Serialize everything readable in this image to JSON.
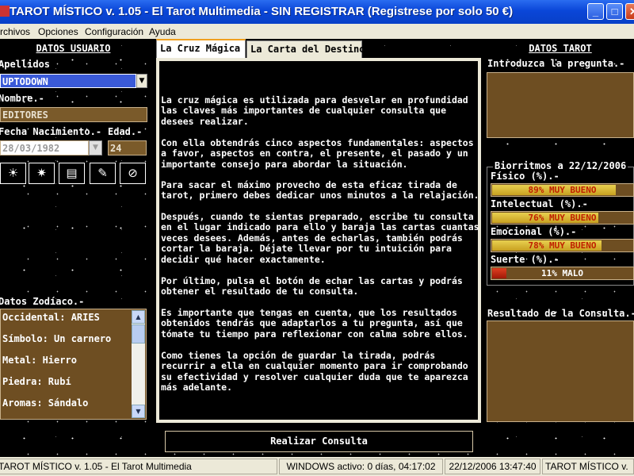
{
  "window": {
    "title": "TAROT MÍSTICO v. 1.05 - El Tarot Multimedia - SIN REGISTRAR (Registrese por solo 50 €)",
    "minimize": "_",
    "maximize": "□",
    "close": "✕"
  },
  "menu": [
    "Archivos",
    "Opciones",
    "Configuración",
    "Ayuda"
  ],
  "left": {
    "title": "DATOS USUARIO",
    "apellidos_label": "Apellidos",
    "apellidos_value": "UPTODOWN",
    "nombre_label": "Nombre.-",
    "nombre_value": "EDITORES",
    "fecha_label": "Fecha Nacimiento.-",
    "edad_label": "Edad.-",
    "fecha_value": "28/03/1982",
    "edad_value": "24",
    "zodiaco_label": "Datos Zodíaco.-",
    "zodiaco": [
      "Occidental: ARIES",
      "Símbolo: Un carnero",
      "Metal: Hierro",
      "Piedra: Rubí",
      "Aromas: Sándalo"
    ]
  },
  "tabs": [
    "La Cruz Mágica",
    "La Carta del Destino"
  ],
  "content": [
    "La cruz mágica es utilizada para desvelar en profundidad las claves más importantes de cualquier consulta que desees realizar.",
    "Con ella obtendrás cinco aspectos fundamentales: aspectos a favor, aspectos en contra, el presente, el pasado y un importante consejo para abordar la situación.",
    "Para sacar el máximo provecho de esta eficaz tirada de tarot, primero debes dedicar unos minutos a la relajación.",
    "Después, cuando te sientas preparado, escribe tu consulta en el lugar indicado para ello y baraja las cartas cuantas veces desees. Además, antes de echarlas, también podrás cortar la baraja. Déjate llevar por tu intuición para decidir qué hacer exactamente.",
    "Por último, pulsa el botón de echar las cartas y podrás obtener el resultado de tu consulta.",
    "Es importante que tengas en cuenta, que los resultados obtenidos tendrás que adaptarlos a tu pregunta, así que tómate tu tiempo para reflexionar con calma sobre ellos.",
    "Como tienes la opción de guardar la tirada, podrás recurrir a ella en cualquier momento para ir comprobando su efectividad y resolver cualquier duda que te aparezca más adelante."
  ],
  "right": {
    "title": "DATOS TAROT",
    "pregunta_label": "Introduzca la pregunta.-",
    "bio_title": "Biorritmos a 22/12/2006",
    "bio": [
      {
        "label": "Físico (%).-",
        "percent": 89,
        "text": "89% MUY BUENO"
      },
      {
        "label": "Intelectual (%).-",
        "percent": 76,
        "text": "76% MUY BUENO"
      },
      {
        "label": "Emocional (%).-",
        "percent": 78,
        "text": "78% MUY BUENO"
      },
      {
        "label": "Suerte (%).-",
        "percent": 11,
        "text": "11% MALO"
      }
    ],
    "resultado_label": "Resultado de la Consulta.-"
  },
  "action_button": "Realizar Consulta",
  "statusbar": [
    "TAROT MÍSTICO v. 1.05 - El Tarot Multimedia",
    "WINDOWS activo: 0 días, 04:17:02",
    "22/12/2006 13:47:40",
    "TAROT MÍSTICO v."
  ],
  "colors": {
    "accent_brown": "#6e4e22",
    "bar_gold": "#c8a020",
    "bar_low": "#c02000",
    "title_blue": "#0a46d8"
  }
}
